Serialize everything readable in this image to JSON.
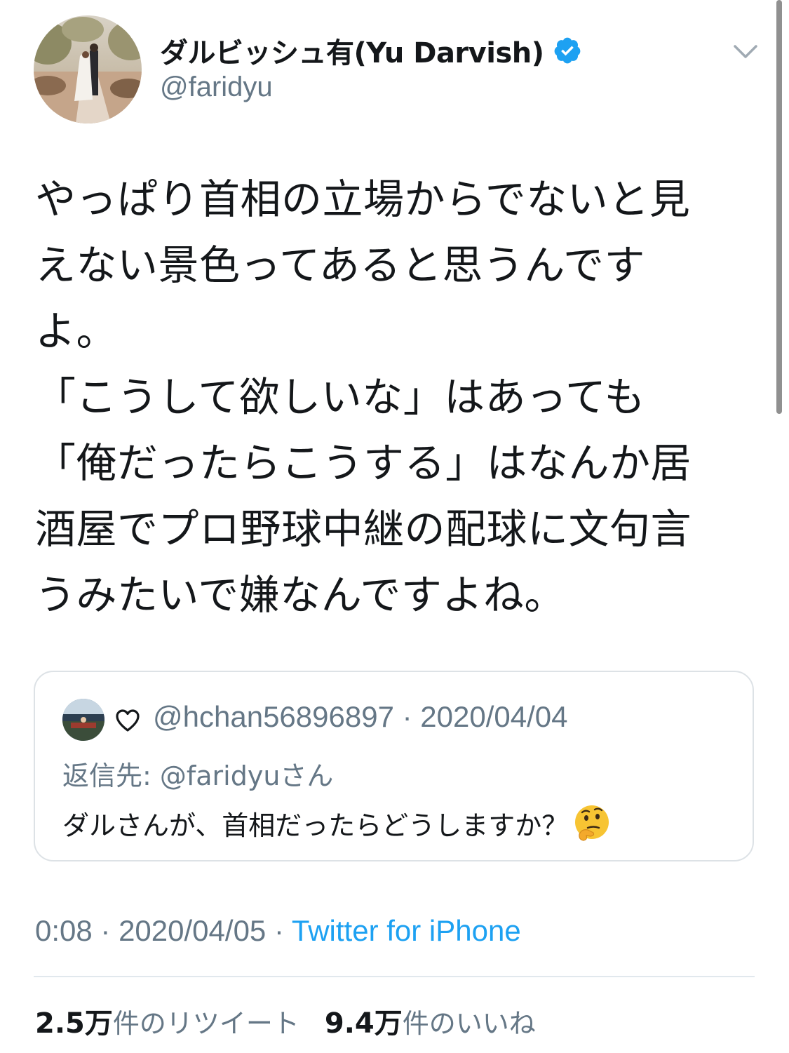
{
  "user": {
    "display_name": "ダルビッシュ有(Yu Darvish)",
    "handle": "@faridyu",
    "verified": true
  },
  "tweet": {
    "text": "やっぱり首相の立場からでないと見\nえない景色ってあると思うんです\nよ。\n「こうして欲しいな」はあっても\n「俺だったらこうする」はなんか居\n酒屋でプロ野球中継の配球に文句言\nうみたいで嫌なんですよね。"
  },
  "quoted_tweet": {
    "heart": "♡",
    "handle": "@hchan56896897",
    "separator": "·",
    "date": "2020/04/04",
    "reply_to": "返信先: @faridyuさん",
    "text": "ダルさんが、首相だったらどうしますか？",
    "emoji": "thinking-face"
  },
  "meta": {
    "time": "0:08",
    "sep1": " · ",
    "date": "2020/04/05",
    "sep2": " · ",
    "source": "Twitter for iPhone"
  },
  "stats": {
    "retweets_value": "2.5万",
    "retweets_label": "件のリツイート",
    "likes_value": "9.4万",
    "likes_label": "件のいいね"
  },
  "colors": {
    "accent": "#1da1f2",
    "secondary_text": "#657786",
    "primary_text": "#14171a",
    "border": "#dde2e6"
  }
}
